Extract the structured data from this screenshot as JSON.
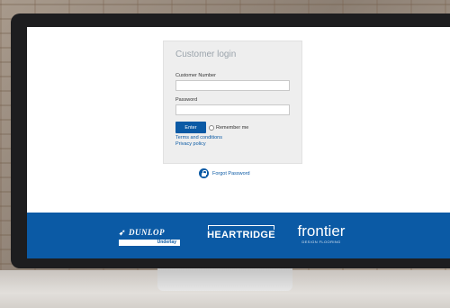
{
  "login": {
    "title": "Customer login",
    "customer_number_label": "Customer Number",
    "customer_number_value": "",
    "password_label": "Password",
    "password_value": "",
    "enter_label": "Enter",
    "remember_label": "Remember me",
    "terms_link": "Terms and conditions",
    "privacy_link": "Privacy policy",
    "forgot_link": "Forgot Password"
  },
  "brands": {
    "dunlop_name": "DUNLOP",
    "dunlop_sub": "Underlay",
    "heartridge_name": "HEARTRIDGE",
    "frontier_name": "frontier",
    "frontier_sub": "DESIGN FLOORING"
  },
  "colors": {
    "brand_blue": "#0b5aa5",
    "card_bg": "#eeeeee",
    "title_grey": "#9aa3ab"
  },
  "icons": {
    "forgot": "lock-icon"
  }
}
